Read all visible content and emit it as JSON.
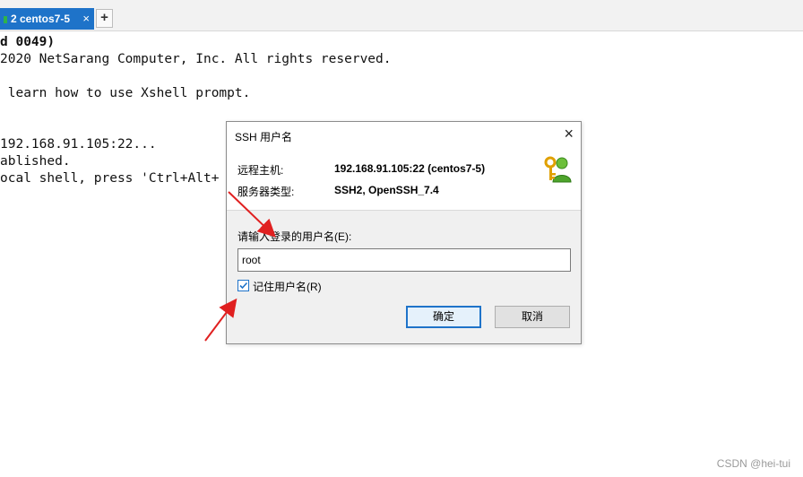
{
  "tab": {
    "label": "2 centos7-5",
    "close": "×",
    "add": "+"
  },
  "terminal": {
    "lines": [
      "d 0049)",
      "2020 NetSarang Computer, Inc. All rights reserved.",
      " learn how to use Xshell prompt.",
      "192.168.91.105:22...",
      "ablished.",
      "ocal shell, press 'Ctrl+Alt+"
    ]
  },
  "dialog": {
    "title": "SSH 用户名",
    "close": "×",
    "remote_host_label": "远程主机:",
    "remote_host_value": "192.168.91.105:22 (centos7-5)",
    "server_type_label": "服务器类型:",
    "server_type_value": "SSH2, OpenSSH_7.4",
    "prompt": "请输入登录的用户名(E):",
    "username": "root",
    "remember_label": "记住用户名(R)",
    "remember_checked": true,
    "ok": "确定",
    "cancel": "取消"
  },
  "icons": {
    "user": "user-key-icon",
    "check": "check-icon"
  },
  "colors": {
    "accent": "#1e73c9",
    "arrow": "#e02020"
  },
  "watermark": "CSDN @hei-tui"
}
